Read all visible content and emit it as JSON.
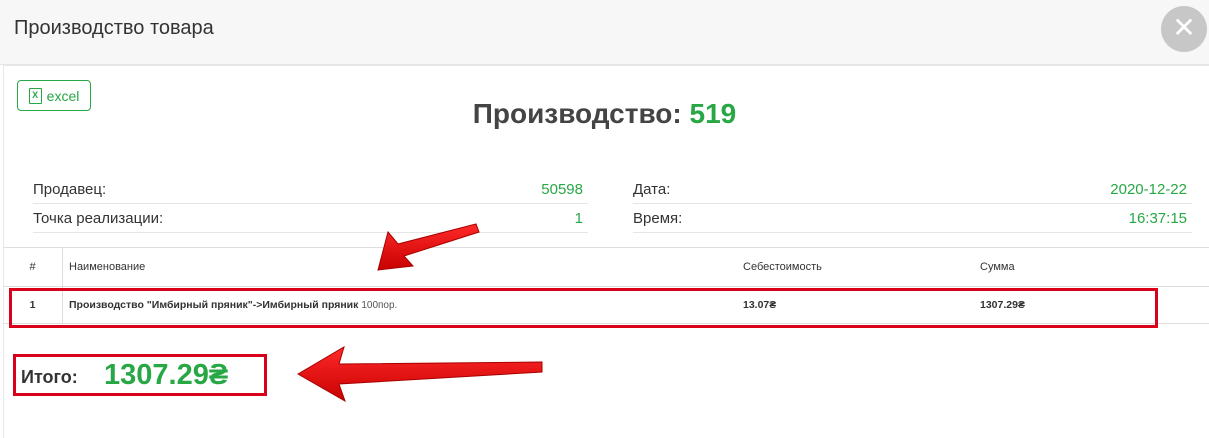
{
  "modal": {
    "title": "Производство товара",
    "close_symbol": "✕"
  },
  "toolbar": {
    "excel_label": "excel",
    "excel_icon": "excel-file-icon",
    "excel_icon_glyph": "X"
  },
  "production": {
    "title_prefix": "Производство:",
    "number": "519"
  },
  "info": {
    "seller_label": "Продавец:",
    "seller_value": "50598",
    "point_label": "Точка реализации:",
    "point_value": "1",
    "date_label": "Дата:",
    "date_value": "2020-12-22",
    "time_label": "Время:",
    "time_value": "16:37:15"
  },
  "table": {
    "headers": [
      "#",
      "Наименование",
      "Себестоимость",
      "Сумма"
    ],
    "rows": [
      {
        "num": "1",
        "name": "Производство \"Имбирный пряник\"->Имбирный пряник",
        "unit": "100пор.",
        "cost": "13.07₴",
        "sum": "1307.29₴"
      }
    ]
  },
  "total": {
    "label": "Итого:",
    "value": "1307.29₴"
  },
  "colors": {
    "accent_green": "#28a745",
    "annotation_red": "#d9001b"
  }
}
